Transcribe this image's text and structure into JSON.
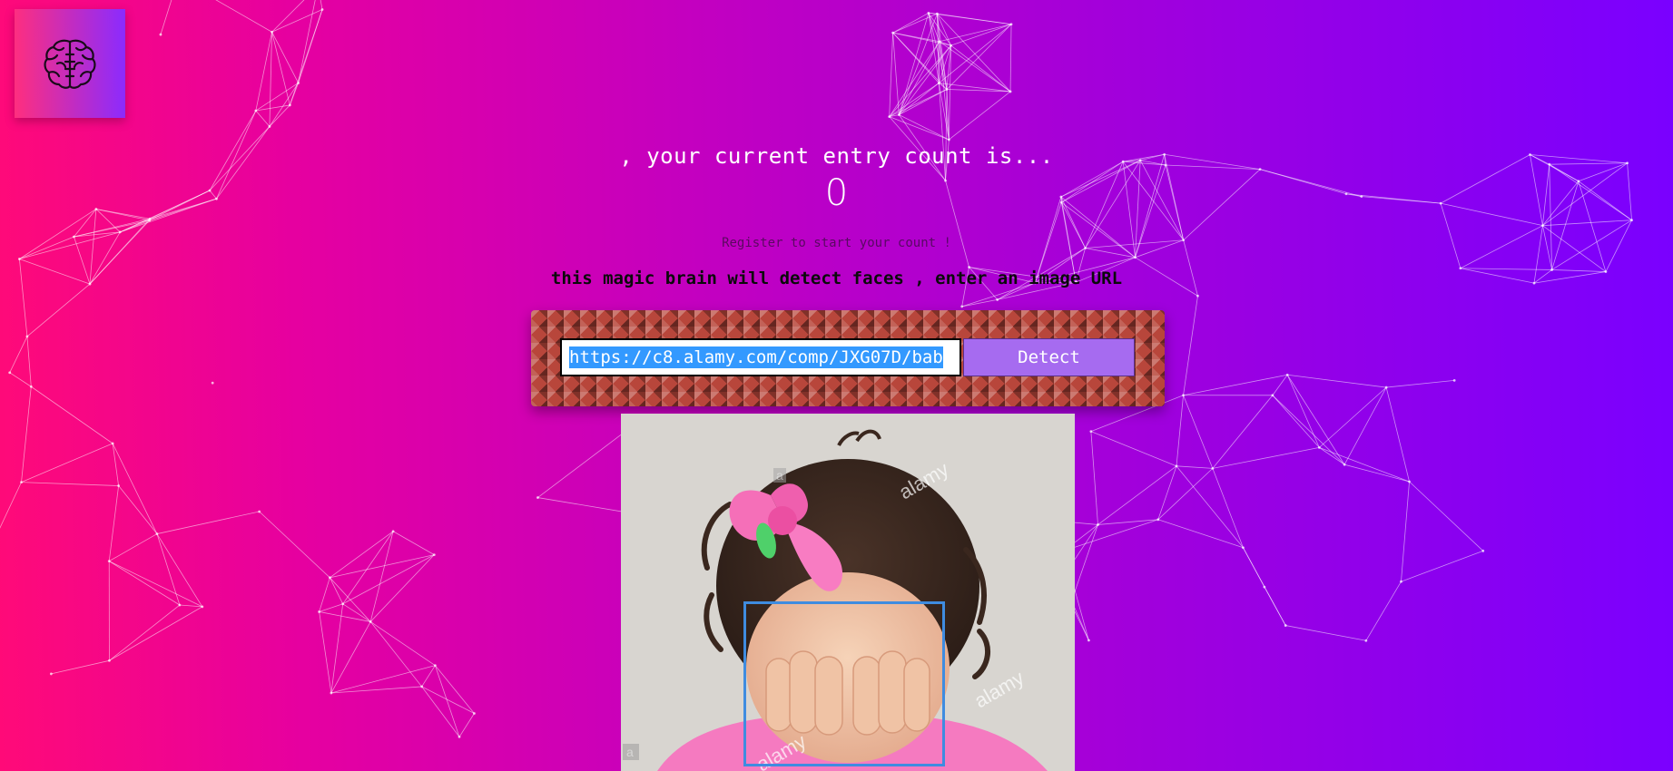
{
  "header": {
    "logo_icon": "brain-icon"
  },
  "rank": {
    "message": ", your current entry count is...",
    "count": "0"
  },
  "register_hint": "Register to start your count !",
  "instructions": "this magic brain will detect faces , enter an image URL",
  "form": {
    "url_value": "https://c8.alamy.com/comp/JXG07D/bab",
    "detect_label": "Detect"
  },
  "result": {
    "image_alt": "toddler with pink bow covering face",
    "watermark": "alamy",
    "box_color": "#3f8ce0"
  },
  "colors": {
    "gradient_start": "#ff0a78",
    "gradient_end": "#7a00ff",
    "detect_button": "#a66bf0"
  }
}
